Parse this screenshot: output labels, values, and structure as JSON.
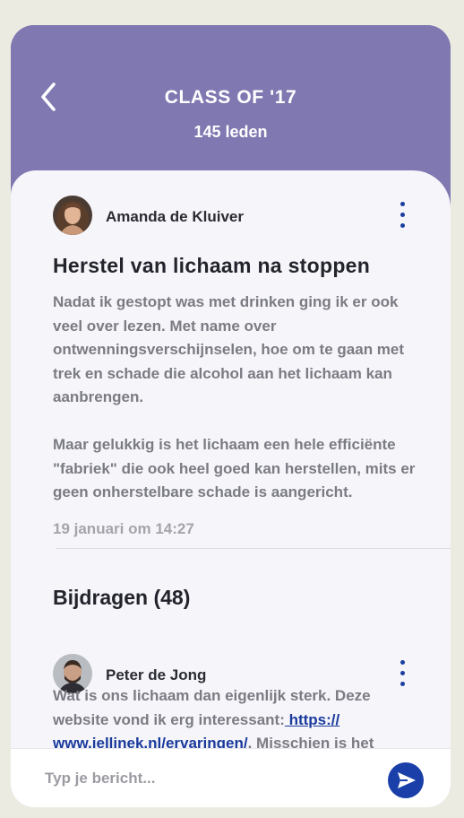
{
  "header": {
    "title": "CLASS OF '17",
    "members": "145 leden"
  },
  "post": {
    "author": "Amanda de Kluiver",
    "title": "Herstel van lichaam na stoppen",
    "paragraphs": [
      "Nadat ik gestopt was met drinken ging ik er ook veel over lezen. Met name over ontwenningsverschijnselen, hoe om te gaan met trek en schade die alcohol aan het lichaam kan aanbrengen.",
      "Maar gelukkig is het lichaam een hele efficiënte \"fabriek\" die ook heel goed kan herstellen, mits er geen onherstelbare schade is aangericht."
    ],
    "date": "19 januari om 14:27"
  },
  "contributions": {
    "title": "Bijdragen (48)"
  },
  "reply": {
    "author": "Peter de Jong",
    "text_before": "Wat is ons lichaam dan eigenlijk sterk. Deze website vond ik erg interessant:",
    "link": " https:// www.jellinek.nl/ervaringen/",
    "text_after": ". Misschien is het"
  },
  "composer": {
    "placeholder": "Typ je bericht..."
  },
  "icons": {
    "back": "chevron-left-icon",
    "more": "vertical-dots-icon",
    "send": "send-arrow-icon"
  },
  "colors": {
    "header": "#8078b1",
    "content_bg": "#f5f5fa",
    "accent": "#1a3fa8",
    "page_bg": "#ecebe2"
  }
}
